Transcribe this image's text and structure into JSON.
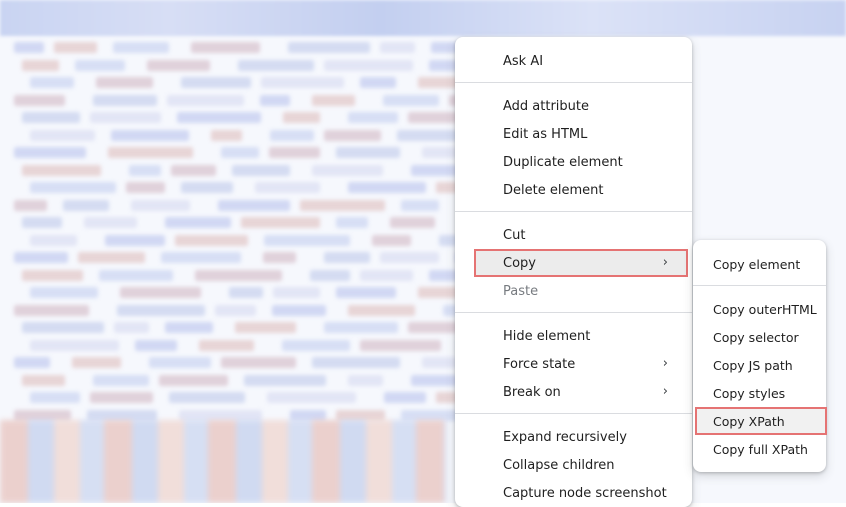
{
  "context_menu": {
    "groups": [
      {
        "items": [
          {
            "label": "Ask AI"
          }
        ]
      },
      {
        "items": [
          {
            "label": "Add attribute"
          },
          {
            "label": "Edit as HTML"
          },
          {
            "label": "Duplicate element"
          },
          {
            "label": "Delete element"
          }
        ]
      },
      {
        "items": [
          {
            "label": "Cut"
          },
          {
            "label": "Copy",
            "has_submenu": true,
            "highlighted": true
          },
          {
            "label": "Paste",
            "disabled": true
          }
        ]
      },
      {
        "items": [
          {
            "label": "Hide element"
          },
          {
            "label": "Force state",
            "has_submenu": true
          },
          {
            "label": "Break on",
            "has_submenu": true
          }
        ]
      },
      {
        "items": [
          {
            "label": "Expand recursively"
          },
          {
            "label": "Collapse children"
          },
          {
            "label": "Capture node screenshot"
          }
        ]
      }
    ],
    "submenu_chevron": "›"
  },
  "copy_submenu": {
    "items": [
      {
        "label": "Copy element"
      },
      {
        "label": "Copy outerHTML"
      },
      {
        "label": "Copy selector"
      },
      {
        "label": "Copy JS path"
      },
      {
        "label": "Copy styles"
      },
      {
        "label": "Copy XPath",
        "highlighted": true
      },
      {
        "label": "Copy full XPath"
      }
    ]
  },
  "colors": {
    "highlight_border": "#e57373",
    "menu_background": "#ffffff",
    "separator": "#dadce0"
  }
}
